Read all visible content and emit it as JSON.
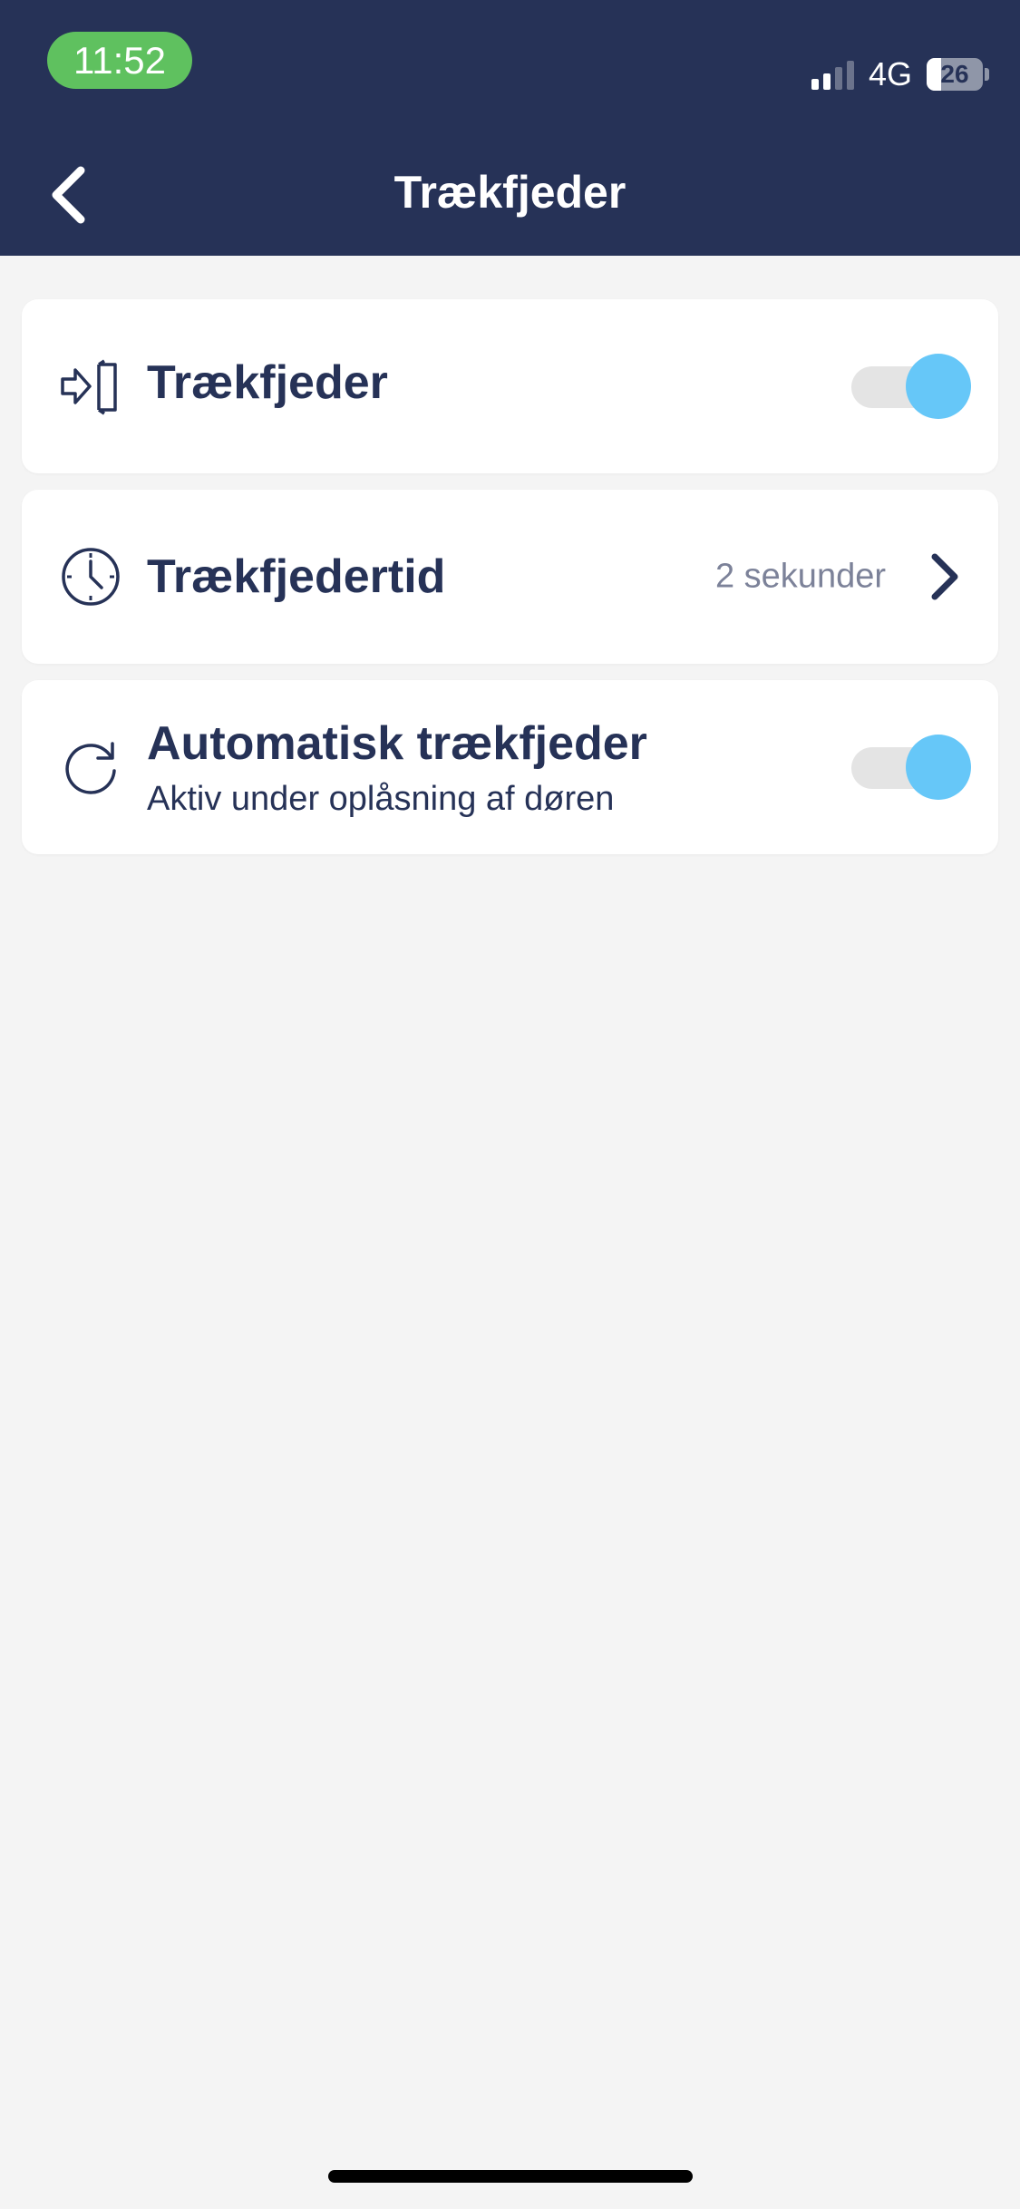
{
  "status_bar": {
    "time": "11:52",
    "network": "4G",
    "battery": "26",
    "battery_level": 0.26,
    "signal_bars_active": 2,
    "signal_bars_total": 4
  },
  "header": {
    "title": "Trækfjeder",
    "back_icon": "chevron-left-icon"
  },
  "settings": [
    {
      "icon": "door-enter-icon",
      "title": "Trækfjeder",
      "control": "toggle",
      "enabled": true
    },
    {
      "icon": "clock-icon",
      "title": "Trækfjedertid",
      "control": "disclosure",
      "value": "2 sekunder"
    },
    {
      "icon": "refresh-icon",
      "title": "Automatisk trækfjeder",
      "subtitle": "Aktiv under oplåsning af døren",
      "control": "toggle",
      "enabled": true
    }
  ],
  "colors": {
    "header_bg": "#263257",
    "text_primary": "#263257",
    "text_secondary": "#7c8299",
    "toggle_on": "#66c7f8",
    "toggle_track": "#e4e4e4",
    "time_pill": "#5fc15f",
    "page_bg": "#f4f4f4"
  }
}
